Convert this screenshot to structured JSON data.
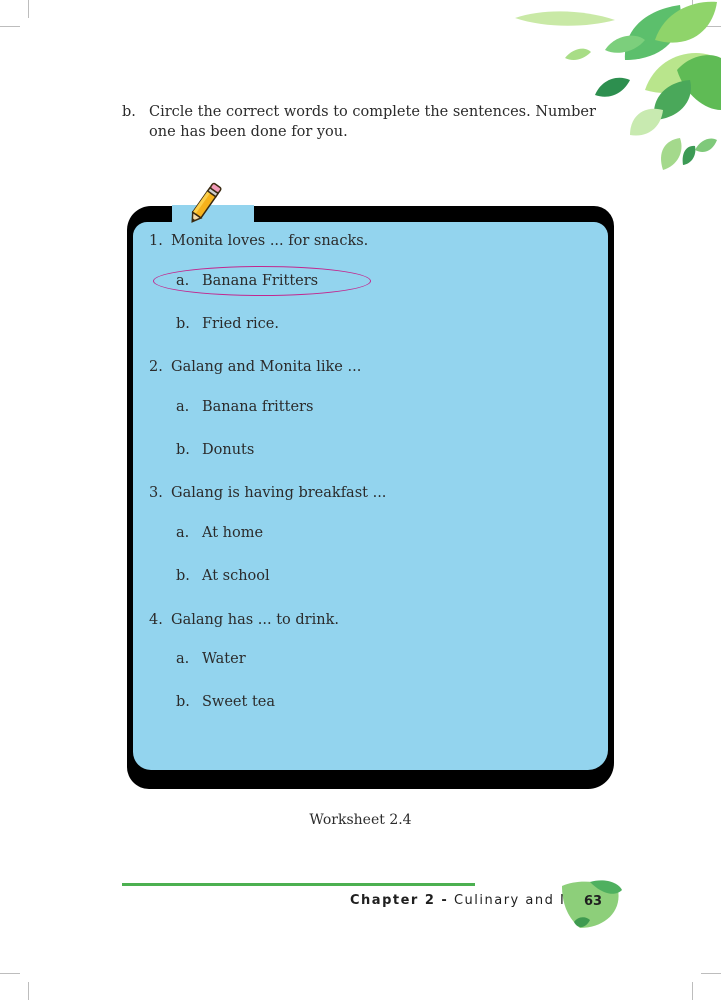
{
  "instruction": {
    "marker": "b.",
    "text": "Circle the correct words to complete the sentences. Number one has been done for you."
  },
  "questions": [
    {
      "number": "1.",
      "text": "Monita loves ... for snacks.",
      "options": [
        {
          "letter": "a.",
          "text": "Banana Fritters",
          "circled": true
        },
        {
          "letter": "b.",
          "text": "Fried rice."
        }
      ]
    },
    {
      "number": "2.",
      "text": "Galang and Monita like ...",
      "options": [
        {
          "letter": "a.",
          "text": "Banana fritters"
        },
        {
          "letter": "b.",
          "text": "Donuts"
        }
      ]
    },
    {
      "number": "3.",
      "text": "Galang is having breakfast ...",
      "options": [
        {
          "letter": "a.",
          "text": "At home"
        },
        {
          "letter": "b.",
          "text": "At school"
        }
      ]
    },
    {
      "number": "4.",
      "text": "Galang has ... to drink.",
      "options": [
        {
          "letter": "a.",
          "text": "Water"
        },
        {
          "letter": "b.",
          "text": "Sweet tea"
        }
      ]
    }
  ],
  "caption": "Worksheet 2.4",
  "footer": {
    "chapter_label": "Chapter 2 -",
    "chapter_title": "Culinary and Me",
    "page_number": "63"
  },
  "colors": {
    "panel": "#93d4ee",
    "frame": "#000000",
    "circle": "#c2288f",
    "accent_green": "#4cb050"
  },
  "icons": [
    "pencil-icon",
    "leaf-decoration-icon"
  ]
}
